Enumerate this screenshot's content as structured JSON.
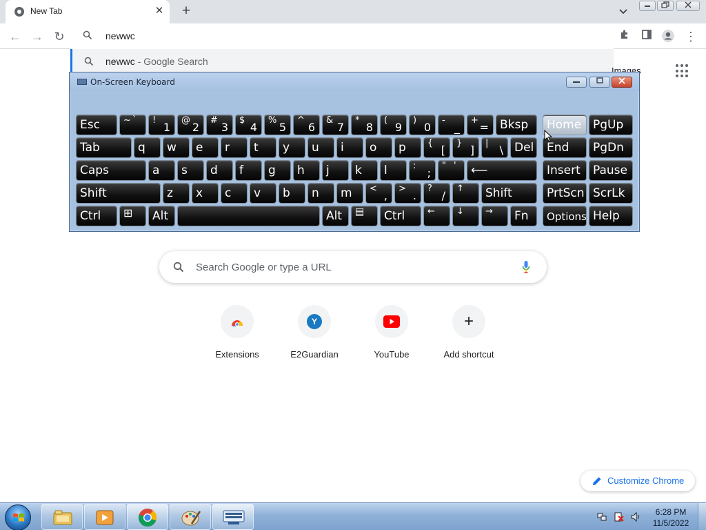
{
  "browser": {
    "tab": {
      "title": "New Tab",
      "close_glyph": "✕",
      "icon": "chrome-tab-favicon"
    },
    "new_tab_glyph": "+",
    "tab_list_glyph": "⌄",
    "window_buttons": {
      "minimize": "—",
      "restore": "❐",
      "close": "✕"
    },
    "nav": {
      "back": "←",
      "forward": "→",
      "reload": "↻"
    },
    "omnibox": {
      "value": "newwc"
    },
    "suggestion": {
      "query": "newwc",
      "sub": " - Google Search"
    },
    "toolbar_icons": [
      "extensions-icon",
      "side-panel-icon",
      "profile-icon",
      "menu-icon"
    ],
    "menu_glyph": "⋮",
    "extensions_glyph": "✦"
  },
  "ntp": {
    "images_link": "Images",
    "search_placeholder": "Search Google or type a URL",
    "shortcuts": [
      {
        "label": "Extensions",
        "icon": "extensions-favicon"
      },
      {
        "label": "E2Guardian",
        "icon": "e2guardian-favicon",
        "letter": "Y"
      },
      {
        "label": "YouTube",
        "icon": "youtube-favicon"
      },
      {
        "label": "Add shortcut",
        "icon": "add-icon",
        "glyph": "+"
      }
    ],
    "customize_label": "Customize Chrome"
  },
  "osk": {
    "title": "On-Screen Keyboard",
    "buttons": {
      "minimize": "—",
      "restore": "▭",
      "close": "✕"
    },
    "keys": {
      "esc": "Esc",
      "tilde_top": "~",
      "tilde_bot": "`",
      "n1_top": "!",
      "n1": "1",
      "n2_top": "@",
      "n2": "2",
      "n3_top": "#",
      "n3": "3",
      "n4_top": "$",
      "n4": "4",
      "n5_top": "%",
      "n5": "5",
      "n6_top": "^",
      "n6": "6",
      "n7_top": "&",
      "n7": "7",
      "n8_top": "*",
      "n8": "8",
      "n9_top": "(",
      "n9": "9",
      "n0_top": ")",
      "n0": "0",
      "minus_top": "-",
      "minus": "_",
      "plus_top": "+",
      "plus": "=",
      "bksp": "Bksp",
      "home": "Home",
      "pgup": "PgUp",
      "tab": "Tab",
      "q": "q",
      "w": "w",
      "e": "e",
      "r": "r",
      "t": "t",
      "y": "y",
      "u": "u",
      "i": "i",
      "o": "o",
      "p": "p",
      "lbr_top": "{",
      "lbr": "[",
      "rbr_top": "}",
      "rbr": "]",
      "bsl_top": "|",
      "bsl": "\\",
      "del": "Del",
      "end": "End",
      "pgdn": "PgDn",
      "caps": "Caps",
      "a": "a",
      "s": "s",
      "d": "d",
      "f": "f",
      "g": "g",
      "h": "h",
      "j": "j",
      "k": "k",
      "l": "l",
      "semi_top": ":",
      "semi": ";",
      "quote_top": "\"",
      "quote": "'",
      "enter": "⟵",
      "insert": "Insert",
      "pause": "Pause",
      "shift": "Shift",
      "z": "z",
      "x": "x",
      "c": "c",
      "v": "v",
      "b": "b",
      "n": "n",
      "m": "m",
      "comma_top": "<",
      "comma": ",",
      "period_top": ">",
      "period": ".",
      "slash_top": "?",
      "slash": "/",
      "up": "↑",
      "shift_r": "Shift",
      "prtscn": "PrtScn",
      "scrlk": "ScrLk",
      "ctrl": "Ctrl",
      "win": "⊞",
      "alt": "Alt",
      "alt_r": "Alt",
      "menu": "▤",
      "ctrl_r": "Ctrl",
      "left": "←",
      "down": "↓",
      "right": "→",
      "fn": "Fn",
      "options": "Options",
      "help": "Help"
    }
  },
  "taskbar": {
    "apps": [
      "file-explorer-icon",
      "media-player-icon",
      "chrome-icon",
      "paint-icon",
      "on-screen-keyboard-icon"
    ],
    "tray": [
      "network-icon",
      "action-center-icon",
      "volume-icon"
    ],
    "time": "6:28 PM",
    "date": "11/5/2022"
  }
}
